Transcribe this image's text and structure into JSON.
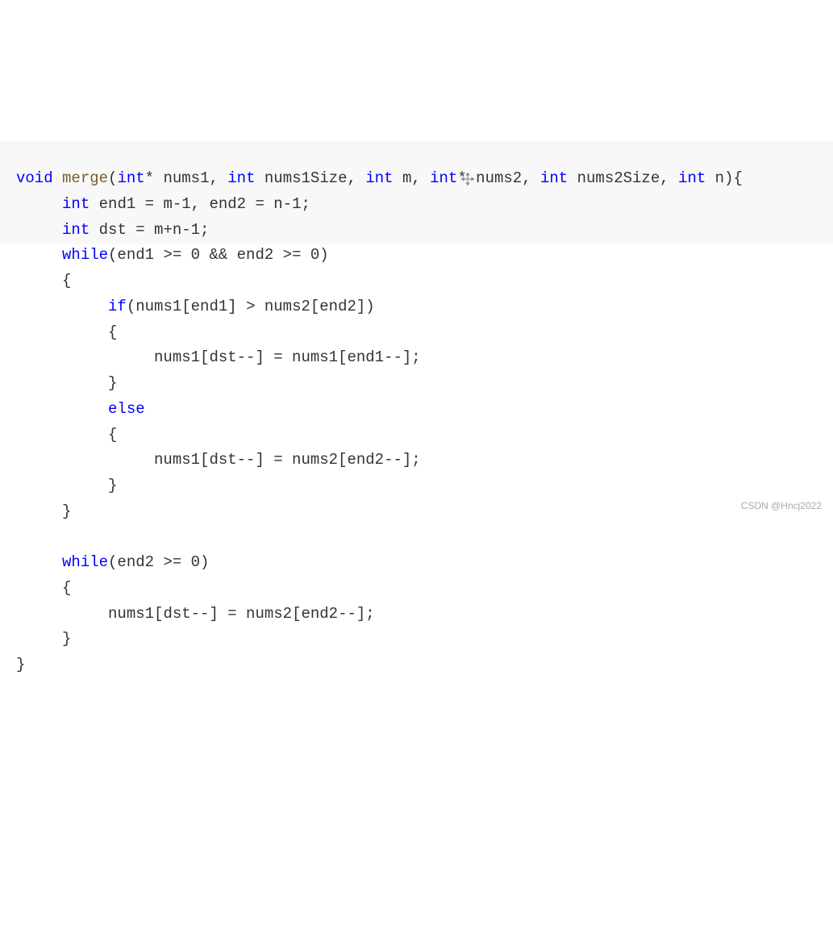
{
  "code": {
    "lines": [
      {
        "indent": 0,
        "segments": [
          {
            "t": "void ",
            "c": "kw"
          },
          {
            "t": "merge",
            "c": "fn"
          },
          {
            "t": "(",
            "c": "tok"
          },
          {
            "t": "int",
            "c": "kw"
          },
          {
            "t": "* nums1, ",
            "c": "tok"
          },
          {
            "t": "int",
            "c": "kw"
          },
          {
            "t": " nums1Size, ",
            "c": "tok"
          },
          {
            "t": "int",
            "c": "kw"
          },
          {
            "t": " m, ",
            "c": "tok"
          },
          {
            "t": "int",
            "c": "kw"
          },
          {
            "t": "* nums2, ",
            "c": "tok"
          },
          {
            "t": "int",
            "c": "kw"
          },
          {
            "t": " nums2Size, ",
            "c": "tok"
          },
          {
            "t": "int",
            "c": "kw"
          },
          {
            "t": " n){",
            "c": "tok"
          }
        ]
      },
      {
        "indent": 1,
        "segments": [
          {
            "t": "int",
            "c": "kw"
          },
          {
            "t": " end1 = m-1, end2 = n-1;",
            "c": "tok"
          }
        ]
      },
      {
        "indent": 1,
        "segments": [
          {
            "t": "int",
            "c": "kw"
          },
          {
            "t": " dst = m+n-1;",
            "c": "tok"
          }
        ]
      },
      {
        "indent": 1,
        "segments": [
          {
            "t": "while",
            "c": "kw"
          },
          {
            "t": "(end1 >= 0 && end2 >= 0)",
            "c": "tok"
          }
        ]
      },
      {
        "indent": 1,
        "segments": [
          {
            "t": "{",
            "c": "tok"
          }
        ]
      },
      {
        "indent": 2,
        "segments": [
          {
            "t": "if",
            "c": "kw"
          },
          {
            "t": "(nums1[end1] > nums2[end2])",
            "c": "tok"
          }
        ]
      },
      {
        "indent": 2,
        "segments": [
          {
            "t": "{",
            "c": "tok"
          }
        ]
      },
      {
        "indent": 3,
        "segments": [
          {
            "t": "nums1[dst--] = nums1[end1--];",
            "c": "tok"
          }
        ]
      },
      {
        "indent": 2,
        "segments": [
          {
            "t": "}",
            "c": "tok"
          }
        ]
      },
      {
        "indent": 2,
        "segments": [
          {
            "t": "else",
            "c": "kw"
          }
        ]
      },
      {
        "indent": 2,
        "segments": [
          {
            "t": "{",
            "c": "tok"
          }
        ]
      },
      {
        "indent": 3,
        "segments": [
          {
            "t": "nums1[dst--] = nums2[end2--];",
            "c": "tok"
          }
        ]
      },
      {
        "indent": 2,
        "segments": [
          {
            "t": "}",
            "c": "tok"
          }
        ]
      },
      {
        "indent": 1,
        "segments": [
          {
            "t": "}",
            "c": "tok"
          }
        ]
      },
      {
        "indent": 0,
        "segments": []
      },
      {
        "indent": 1,
        "segments": [
          {
            "t": "while",
            "c": "kw"
          },
          {
            "t": "(end2 >= 0)",
            "c": "tok"
          }
        ]
      },
      {
        "indent": 1,
        "segments": [
          {
            "t": "{",
            "c": "tok"
          }
        ]
      },
      {
        "indent": 2,
        "segments": [
          {
            "t": "nums1[dst--] = nums2[end2--];",
            "c": "tok"
          }
        ]
      },
      {
        "indent": 1,
        "segments": [
          {
            "t": "}",
            "c": "tok"
          }
        ]
      },
      {
        "indent": 0,
        "segments": [
          {
            "t": "}",
            "c": "tok"
          }
        ]
      }
    ],
    "indent_unit": "     "
  },
  "watermark": "CSDN @Hncj2022",
  "faint_watermark": ""
}
